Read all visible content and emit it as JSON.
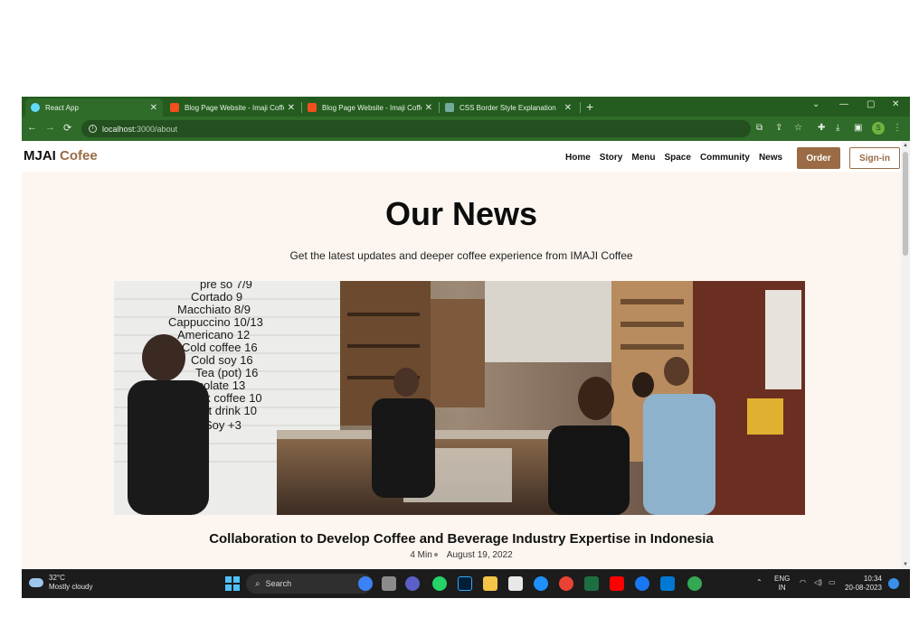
{
  "browser": {
    "tabs": [
      {
        "title": "React App",
        "favicon_color": "#61dafb",
        "active": true
      },
      {
        "title": "Blog Page Website - Imaji Coffee",
        "favicon_color": "#f24e1e",
        "active": false
      },
      {
        "title": "Blog Page Website - Imaji Coffee",
        "favicon_color": "#f24e1e",
        "active": false
      },
      {
        "title": "CSS Border Style Explanation",
        "favicon_color": "#74aa9c",
        "active": false
      }
    ],
    "new_tab": "+",
    "address": {
      "host": "localhost",
      "path": ":3000/about"
    },
    "profile_initial": "S",
    "window_controls": {
      "dropdown": "⌄",
      "minimize": "—",
      "maximize": "▢",
      "close": "✕"
    }
  },
  "site": {
    "logo_main": "MJAI",
    "logo_accent": "Cofee",
    "nav": [
      "Home",
      "Story",
      "Menu",
      "Space",
      "Community",
      "News"
    ],
    "order_label": "Order",
    "signin_label": "Sign-in",
    "hero_title": "Our News",
    "hero_subtitle": "Get the latest updates and deeper coffee experience from IMAJI Coffee",
    "post": {
      "title": "Collaboration to Develop Coffee and Beverage Industry Expertise in Indonesia",
      "read_time": "4 Min",
      "date": "August 19, 2022"
    },
    "menu_board": [
      "pre so 7/9",
      "Cortado 9",
      "Macchiato 8/9",
      "Cappuccino 10/13",
      "Americano 12",
      "Cold coffee 16",
      "Cold soy 16",
      "Tea (pot) 16",
      "hocolate 13",
      "Black coffee 10",
      "Soft drink 10",
      "Soy +3"
    ]
  },
  "colors": {
    "accent": "#9a6b44",
    "page_bg": "#fdf6f0",
    "chrome_green": "#2f6b29"
  },
  "taskbar": {
    "temperature": "32°C",
    "weather": "Mostly cloudy",
    "search_label": "Search",
    "language": "ENG",
    "region": "IN",
    "time": "10:34",
    "date": "20-08-2023"
  }
}
